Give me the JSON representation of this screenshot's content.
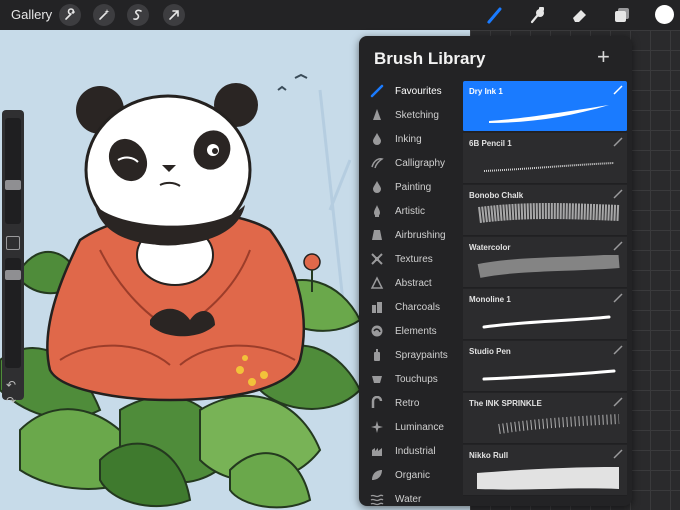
{
  "topbar": {
    "gallery_label": "Gallery",
    "left_tools": [
      "wrench-icon",
      "magic-wand-icon",
      "selection-icon",
      "transform-icon"
    ],
    "right_tools": [
      "brush-icon",
      "smudge-icon",
      "eraser-icon",
      "layers-icon"
    ],
    "active_tool": "brush-icon",
    "current_color": "#ffffff"
  },
  "panel": {
    "title": "Brush Library",
    "add_label": "+",
    "categories": [
      {
        "label": "Favourites",
        "icon": "brush-stroke-icon",
        "selected": true
      },
      {
        "label": "Sketching",
        "icon": "pencil-tip-icon"
      },
      {
        "label": "Inking",
        "icon": "ink-drop-icon"
      },
      {
        "label": "Calligraphy",
        "icon": "calligraphy-icon"
      },
      {
        "label": "Painting",
        "icon": "paint-drop-icon"
      },
      {
        "label": "Artistic",
        "icon": "artistic-icon"
      },
      {
        "label": "Airbrushing",
        "icon": "airbrush-icon"
      },
      {
        "label": "Textures",
        "icon": "texture-icon"
      },
      {
        "label": "Abstract",
        "icon": "abstract-icon"
      },
      {
        "label": "Charcoals",
        "icon": "charcoal-icon"
      },
      {
        "label": "Elements",
        "icon": "elements-icon"
      },
      {
        "label": "Spraypaints",
        "icon": "spraypaint-icon"
      },
      {
        "label": "Touchups",
        "icon": "touchups-icon"
      },
      {
        "label": "Retro",
        "icon": "retro-icon"
      },
      {
        "label": "Luminance",
        "icon": "luminance-icon"
      },
      {
        "label": "Industrial",
        "icon": "industrial-icon"
      },
      {
        "label": "Organic",
        "icon": "leaf-icon"
      },
      {
        "label": "Water",
        "icon": "water-icon"
      }
    ],
    "brushes": [
      {
        "name": "Dry Ink 1",
        "selected": true
      },
      {
        "name": "6B Pencil 1"
      },
      {
        "name": "Bonobo Chalk"
      },
      {
        "name": "Watercolor"
      },
      {
        "name": "Monoline 1"
      },
      {
        "name": "Studio Pen"
      },
      {
        "name": "The INK SPRINKLE"
      },
      {
        "name": "Nikko Rull"
      }
    ]
  },
  "colors": {
    "accent": "#1a7bff",
    "panel_bg": "#232325",
    "canvas_bg": "#c7dbe9"
  }
}
